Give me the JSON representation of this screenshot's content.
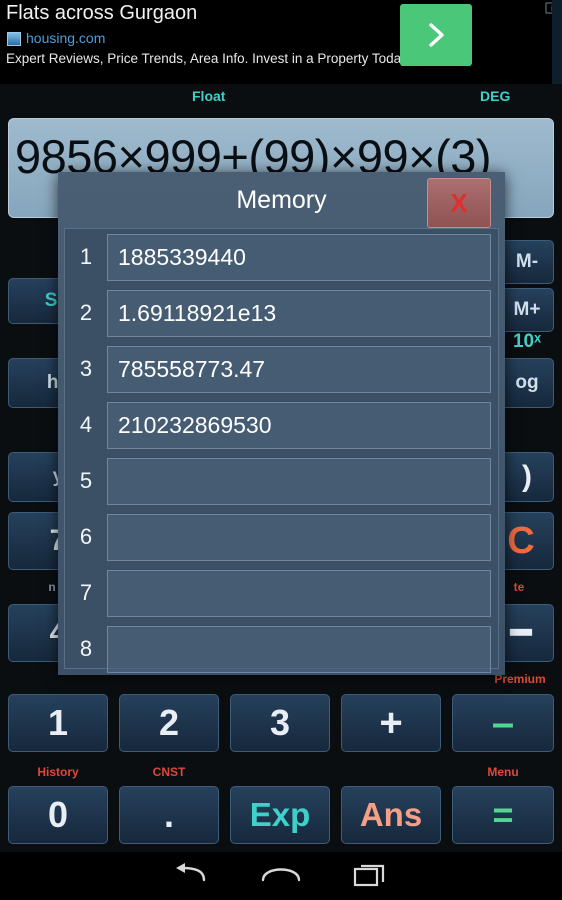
{
  "ad": {
    "title": "Flats across Gurgaon",
    "url": "housing.com",
    "description": "Expert Reviews, Price Trends, Area Info. Invest in a Property Today!",
    "cta_icon": "chevron-right-icon",
    "info_icon": "ad-info-icon"
  },
  "status": {
    "notation": "Float",
    "angle_unit": "DEG"
  },
  "display": {
    "expression": "9856×999+(99)×99×(3)"
  },
  "dialog": {
    "title": "Memory",
    "close_label": "X",
    "rows": [
      {
        "index": "1",
        "value": "1885339440"
      },
      {
        "index": "2",
        "value": "1.69118921e13"
      },
      {
        "index": "3",
        "value": "785558773.47"
      },
      {
        "index": "4",
        "value": "210232869530"
      },
      {
        "index": "5",
        "value": ""
      },
      {
        "index": "6",
        "value": ""
      },
      {
        "index": "7",
        "value": ""
      },
      {
        "index": "8",
        "value": ""
      }
    ]
  },
  "keypad": {
    "obscured_row_labels": {
      "shift": "SH",
      "hyp": "hy",
      "mem_minus": "M-",
      "mem_plus": "M+",
      "ten_pow": "10ˣ",
      "log": "og",
      "paren_close": ")",
      "clear": "C",
      "seven": "7",
      "four": "4",
      "y_pow": "y"
    },
    "top_labels": {
      "rand": "n",
      "delete": "te",
      "premium": "Premium",
      "history": "History",
      "cnst": "CNST",
      "menu": "Menu"
    },
    "rows": [
      [
        {
          "name": "key-1",
          "label": "1",
          "style": "num"
        },
        {
          "name": "key-2",
          "label": "2",
          "style": "num"
        },
        {
          "name": "key-3",
          "label": "3",
          "style": "num"
        },
        {
          "name": "key-plus",
          "label": "+",
          "style": "num"
        },
        {
          "name": "key-minus",
          "label": "–",
          "style": "green"
        }
      ],
      [
        {
          "name": "key-0",
          "label": "0",
          "style": "num"
        },
        {
          "name": "key-dot",
          "label": ".",
          "style": "num"
        },
        {
          "name": "key-exp",
          "label": "Exp",
          "style": "teal"
        },
        {
          "name": "key-ans",
          "label": "Ans",
          "style": "salmon"
        },
        {
          "name": "key-equals",
          "label": "=",
          "style": "green"
        }
      ]
    ]
  },
  "navbar": {
    "back_icon": "back-arrow-icon",
    "home_icon": "home-icon",
    "recents_icon": "recent-apps-icon"
  },
  "colors": {
    "accent_teal": "#3fd0c9",
    "accent_red": "#e0473a",
    "accent_green": "#53d98f",
    "dialog_bg": "#41566b",
    "key_bg": "#1b2f45"
  }
}
